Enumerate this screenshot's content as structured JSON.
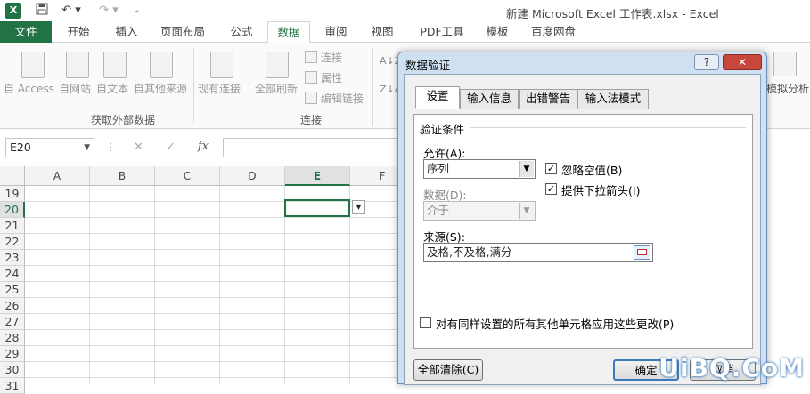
{
  "window": {
    "title": "新建 Microsoft Excel 工作表.xlsx - Excel",
    "logo": "X",
    "qat": [
      "save-icon",
      "undo-icon",
      "redo-icon",
      "customize-icon"
    ]
  },
  "tabs": [
    "文件",
    "开始",
    "插入",
    "页面布局",
    "公式",
    "数据",
    "审阅",
    "视图",
    "PDF工具",
    "模板",
    "百度网盘"
  ],
  "active_tab": "数据",
  "ribbon": {
    "external_group": {
      "buttons": [
        "自 Access",
        "自网站",
        "自文本",
        "自其他来源",
        "现有连接"
      ],
      "label": "获取外部数据"
    },
    "connections_group": {
      "refresh_all": "全部刷新",
      "small_items": [
        "连接",
        "属性",
        "编辑链接"
      ],
      "label": "连接"
    },
    "sort_icons": [
      "A↓Z",
      "Z↓A"
    ],
    "right_partial": "模拟分析"
  },
  "formula_bar": {
    "name_box": "E20",
    "fx": "fx",
    "cancel": "✕",
    "enter": "✓"
  },
  "grid": {
    "columns": [
      "A",
      "B",
      "C",
      "D",
      "E",
      "F"
    ],
    "active_column": "E",
    "rows": [
      "19",
      "20",
      "21",
      "22",
      "23",
      "24",
      "25",
      "26",
      "27",
      "28",
      "29",
      "30",
      "31"
    ],
    "active_row": "20"
  },
  "dialog": {
    "title": "数据验证",
    "help_btn": "?",
    "close_btn": "✕",
    "tabs": [
      "设置",
      "输入信息",
      "出错警告",
      "输入法模式"
    ],
    "active_tab": "设置",
    "section": "验证条件",
    "allow_label": "允许(A):",
    "allow_value": "序列",
    "ignore_blank": "忽略空值(B)",
    "ignore_blank_checked": true,
    "dropdown_arrow": "提供下拉箭头(I)",
    "dropdown_arrow_checked": true,
    "data_label": "数据(D):",
    "data_value": "介于",
    "source_label": "来源(S):",
    "source_value": "及格,不及格,满分",
    "apply_all": "对有同样设置的所有其他单元格应用这些更改(P)",
    "apply_all_checked": false,
    "clear_all": "全部清除(C)",
    "ok": "确定",
    "cancel": "取消"
  },
  "watermark": "UiBQ.CoM"
}
